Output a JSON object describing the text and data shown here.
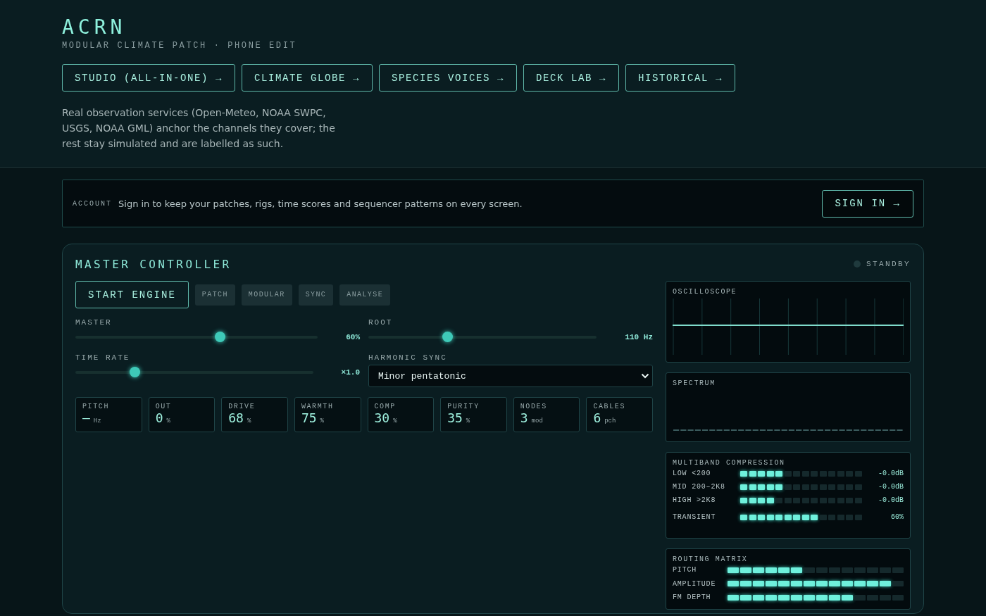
{
  "header": {
    "title": "ACRN",
    "subtitle": "MODULAR CLIMATE PATCH · PHONE EDIT",
    "nav": [
      "STUDIO (ALL-IN-ONE) →",
      "CLIMATE GLOBE →",
      "SPECIES VOICES →",
      "DECK LAB →",
      "HISTORICAL →"
    ],
    "note": "Real observation services (Open-Meteo, NOAA SWPC, USGS, NOAA GML) anchor the channels they cover; the rest stay simulated and are labelled as such."
  },
  "account": {
    "label": "ACCOUNT",
    "message": "Sign in to keep your patches, rigs, time scores and sequencer patterns on every screen.",
    "button": "SIGN IN →"
  },
  "master": {
    "title": "MASTER CONTROLLER",
    "status": {
      "label": "STANDBY",
      "active": false
    },
    "start_button": "START ENGINE",
    "modes": [
      "PATCH",
      "MODULAR",
      "SYNC",
      "ANALYSE"
    ],
    "sliders": [
      {
        "label": "MASTER",
        "level": 0.6,
        "reading": "60%"
      },
      {
        "label": "ROOT",
        "level": 0.34,
        "reading": "110 Hz"
      },
      {
        "label": "TIME RATE",
        "level": 0.24,
        "reading": "×1.0"
      }
    ],
    "harmonic_sync": {
      "label": "HARMONIC SYNC",
      "value": "Minor pentatonic"
    },
    "stats": [
      {
        "label": "PITCH",
        "value": "—",
        "unit": "Hz"
      },
      {
        "label": "OUT",
        "value": "0",
        "unit": "%"
      },
      {
        "label": "DRIVE",
        "value": "68",
        "unit": "%"
      },
      {
        "label": "WARMTH",
        "value": "75",
        "unit": "%"
      },
      {
        "label": "COMP",
        "value": "30",
        "unit": "%"
      },
      {
        "label": "PURITY",
        "value": "35",
        "unit": "%"
      },
      {
        "label": "NODES",
        "value": "3",
        "unit": "mod"
      },
      {
        "label": "CABLES",
        "value": "6",
        "unit": "pch"
      }
    ],
    "oscilloscope": {
      "title": "OSCILLOSCOPE"
    },
    "spectrum": {
      "title": "SPECTRUM"
    },
    "multiband": {
      "title": "MULTIBAND COMPRESSION",
      "bands": [
        {
          "label": "LOW <200",
          "level": 0.357,
          "reading": "-0.0dB"
        },
        {
          "label": "MID 200–2K8",
          "level": 0.357,
          "reading": "-0.0dB"
        },
        {
          "label": "HIGH >2K8",
          "level": 0.286,
          "reading": "-0.0dB"
        },
        {
          "label": "TRANSIENT",
          "level": 0.643,
          "reading": "60%"
        }
      ]
    },
    "routing": {
      "title": "ROUTING MATRIX",
      "rows": [
        {
          "label": "PITCH",
          "level": 0.429
        },
        {
          "label": "AMPLITUDE",
          "level": 0.929
        },
        {
          "label": "FM DEPTH",
          "level": 0.714
        }
      ]
    }
  }
}
